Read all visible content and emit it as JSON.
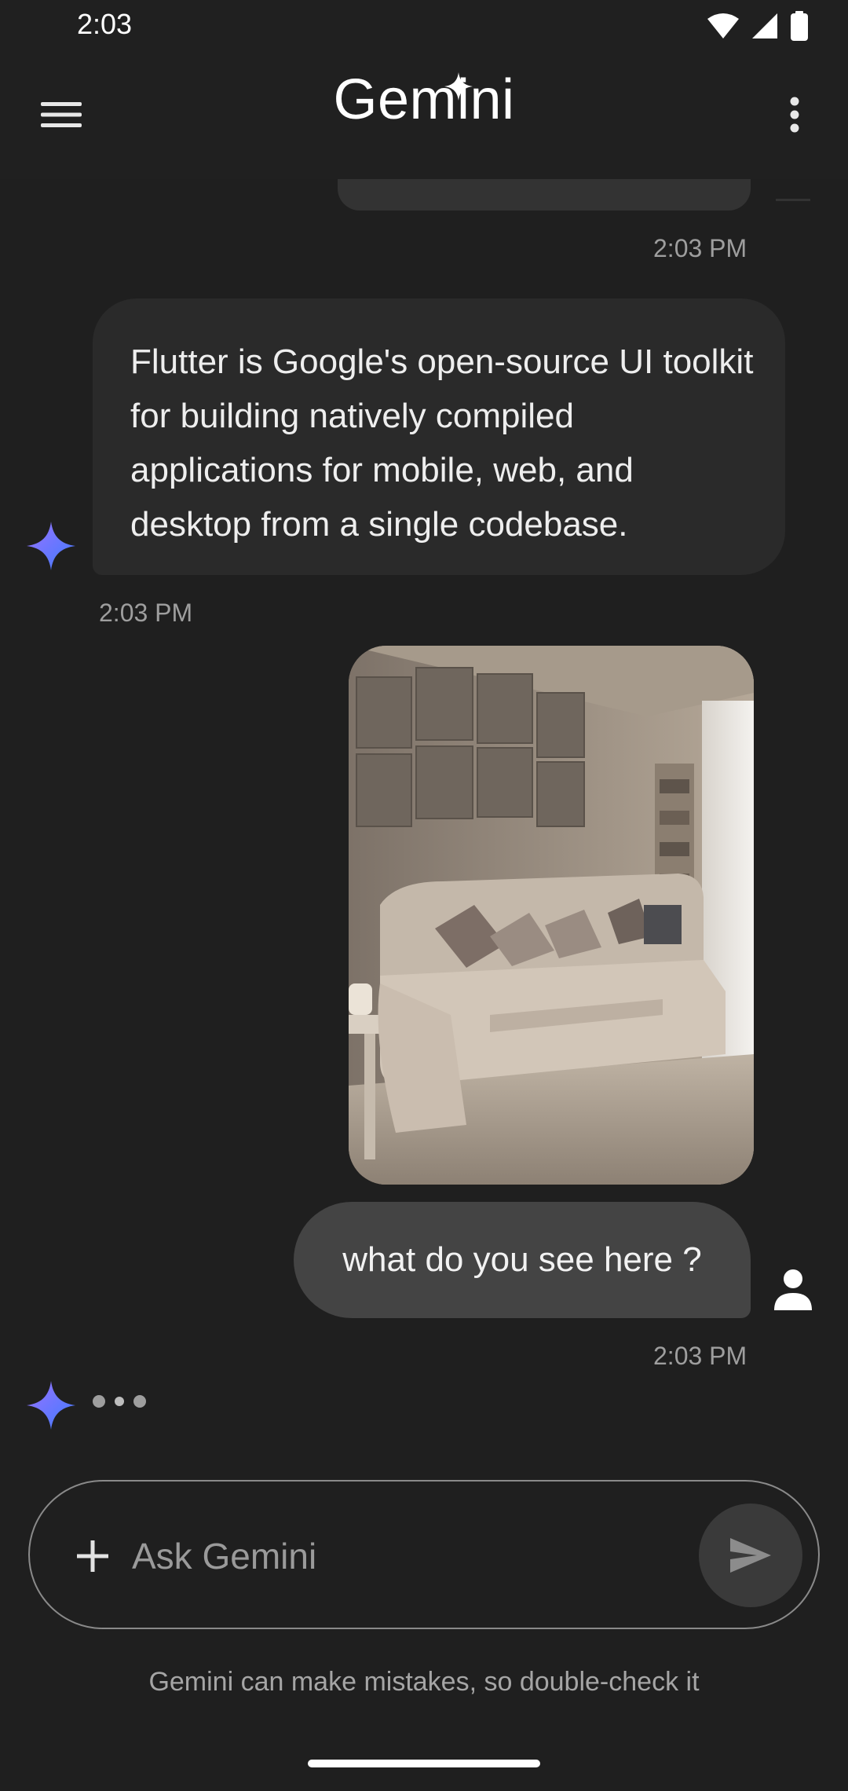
{
  "status_bar": {
    "time": "2:03",
    "icons": [
      "wifi-icon",
      "signal-icon",
      "battery-icon"
    ]
  },
  "app_bar": {
    "title": "Gemini",
    "menu_icon": "menu-icon",
    "more_icon": "more-vert-icon"
  },
  "messages": [
    {
      "role": "user",
      "type": "text",
      "timestamp": "2:03 PM"
    },
    {
      "role": "bot",
      "type": "text",
      "text": "Flutter is Google's open-source UI toolkit for building natively compiled applications for mobile, web, and desktop from a single codebase.",
      "timestamp": "2:03 PM"
    },
    {
      "role": "user",
      "type": "image",
      "alt": "Living room with beige sofa and wall panels"
    },
    {
      "role": "user",
      "type": "text",
      "text": "what do you see here ?",
      "timestamp": "2:03 PM"
    },
    {
      "role": "bot",
      "type": "typing"
    }
  ],
  "input": {
    "placeholder": "Ask Gemini",
    "value": "",
    "plus_icon": "plus-icon",
    "send_icon": "send-icon"
  },
  "disclaimer": "Gemini can make mistakes, so double-check it",
  "colors": {
    "background": "#1f1f1f",
    "bot_bubble": "#2a2a2a",
    "user_bubble": "#444444",
    "sparkle_blue": "#4f7dff"
  }
}
